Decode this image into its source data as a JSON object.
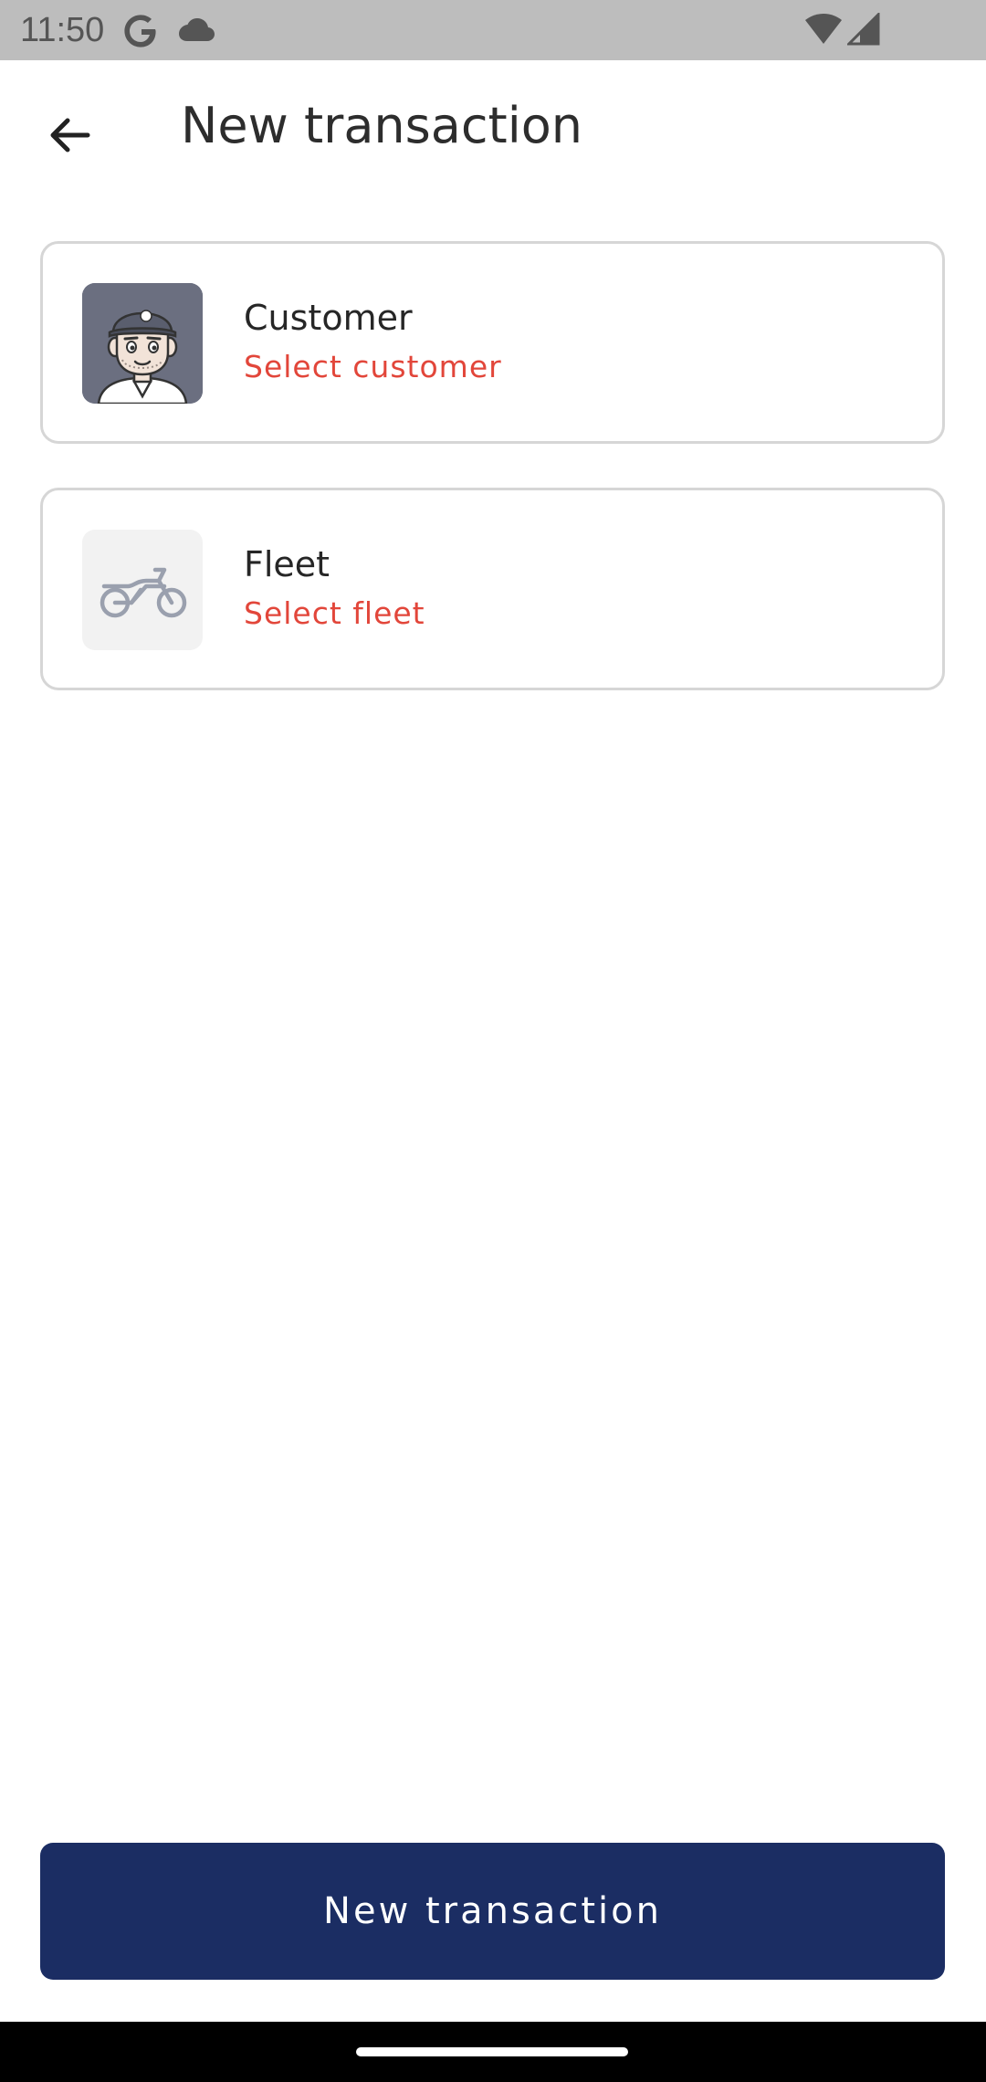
{
  "status_bar": {
    "time": "11:50",
    "icons": [
      "google-icon",
      "cloud-icon",
      "wifi-icon",
      "signal-icon"
    ]
  },
  "app_bar": {
    "back_icon": "arrow-left-icon",
    "title": "New transaction"
  },
  "cards": [
    {
      "title": "Customer",
      "subtitle": "Select customer",
      "icon": "customer-avatar-icon"
    },
    {
      "title": "Fleet",
      "subtitle": "Select fleet",
      "icon": "motorcycle-icon"
    }
  ],
  "primary_button": {
    "label": "New transaction"
  },
  "colors": {
    "status_bar_bg": "#bdbdbd",
    "accent_red": "#e2463a",
    "primary_navy": "#1b2d63",
    "card_border": "#d6d6d6",
    "nav_bar_bg": "#000000"
  }
}
